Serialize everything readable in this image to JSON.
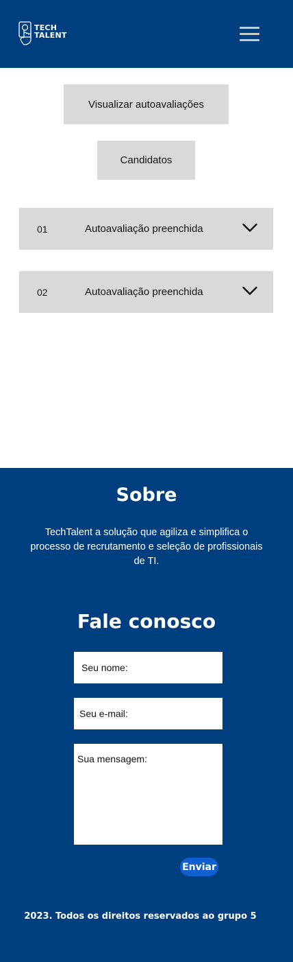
{
  "header": {
    "logo_line1": "TECH",
    "logo_line2": "TALENT",
    "menu_icon": "hamburger-menu-icon",
    "bg_color": "#003F7F"
  },
  "main": {
    "view_button_label": "Visualizar autoavaliações",
    "candidates_button_label": "Candidatos",
    "evaluations": [
      {
        "number": "01",
        "label": "Autoavaliação preenchida",
        "icon": "chevron-down-icon"
      },
      {
        "number": "02",
        "label": "Autoavaliação preenchida",
        "icon": "chevron-down-icon"
      }
    ]
  },
  "footer": {
    "about_title": "Sobre",
    "about_text": "TechTalent a solução que agiliza e simplifica o processo de recrutamento e seleção de profissionais de TI.",
    "contact_title": "Fale conosco",
    "name_placeholder": "Seu nome:",
    "email_placeholder": "Seu e-mail:",
    "message_placeholder": "Sua mensagem:",
    "send_label": "Enviar",
    "send_color": "#0F5FD0",
    "copyright": "2023. Todos os direitos reservados ao grupo 5"
  }
}
